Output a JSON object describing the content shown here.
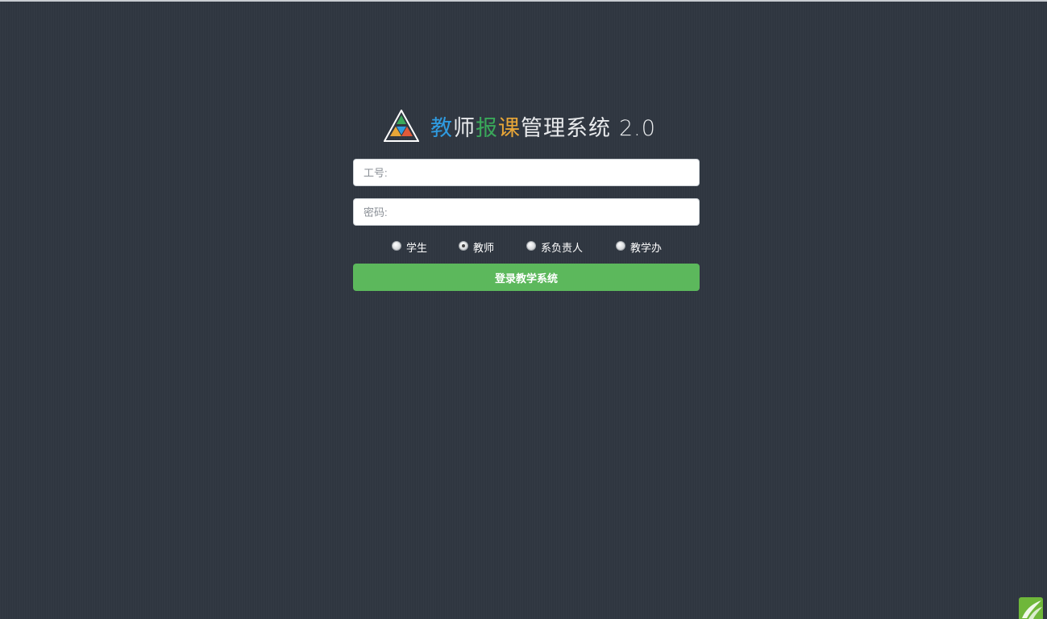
{
  "header": {
    "title_parts": [
      "教",
      "师",
      "报",
      "课",
      "管理系统"
    ],
    "version": "2.0"
  },
  "form": {
    "username_placeholder": "工号:",
    "password_placeholder": "密码:",
    "roles": [
      {
        "label": "学生",
        "checked": false
      },
      {
        "label": "教师",
        "checked": true
      },
      {
        "label": "系负责人",
        "checked": false
      },
      {
        "label": "教学办",
        "checked": false
      }
    ],
    "login_label": "登录教学系统"
  },
  "colors": {
    "background": "#2f3640",
    "button": "#5cb85c",
    "title_blue": "#2f9be0",
    "title_green": "#3aa85a",
    "title_orange": "#e8a637"
  },
  "icons": {
    "logo": "triangle-logo-icon",
    "corner": "leaf-badge-icon"
  }
}
